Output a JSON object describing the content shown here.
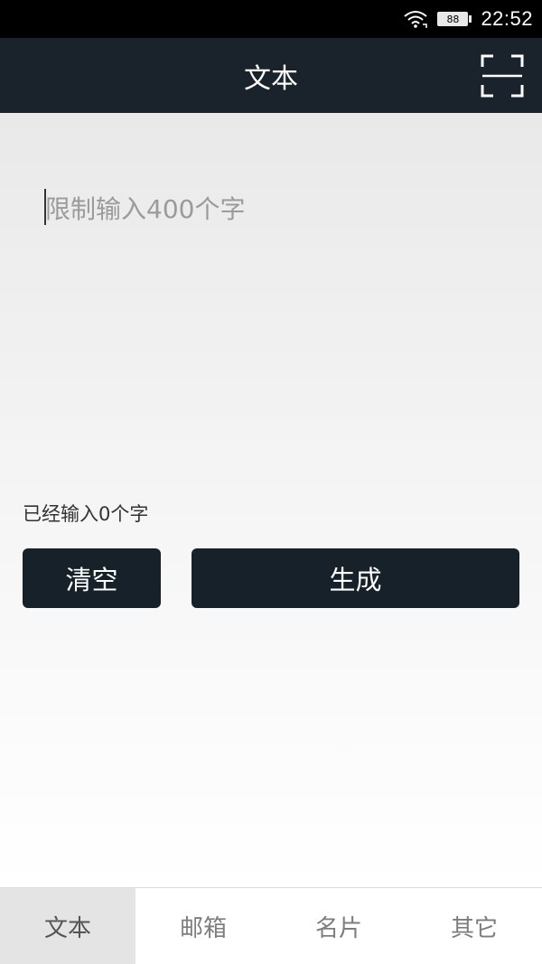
{
  "status_bar": {
    "battery_level": "88",
    "time": "22:52",
    "icons": [
      "wifi-icon",
      "battery-icon"
    ]
  },
  "app_bar": {
    "title": "文本",
    "action_icon": "scan-icon"
  },
  "editor": {
    "placeholder": "限制输入400个字",
    "value": "",
    "count_text": "已经输入0个字"
  },
  "buttons": {
    "clear_label": "清空",
    "generate_label": "生成"
  },
  "tabs": [
    {
      "label": "文本",
      "active": true
    },
    {
      "label": "邮箱",
      "active": false
    },
    {
      "label": "名片",
      "active": false
    },
    {
      "label": "其它",
      "active": false
    }
  ],
  "colors": {
    "app_bar": "#1a232c",
    "button": "#17212a",
    "status_bar": "#000000",
    "active_tab": "#e4e4e4"
  }
}
